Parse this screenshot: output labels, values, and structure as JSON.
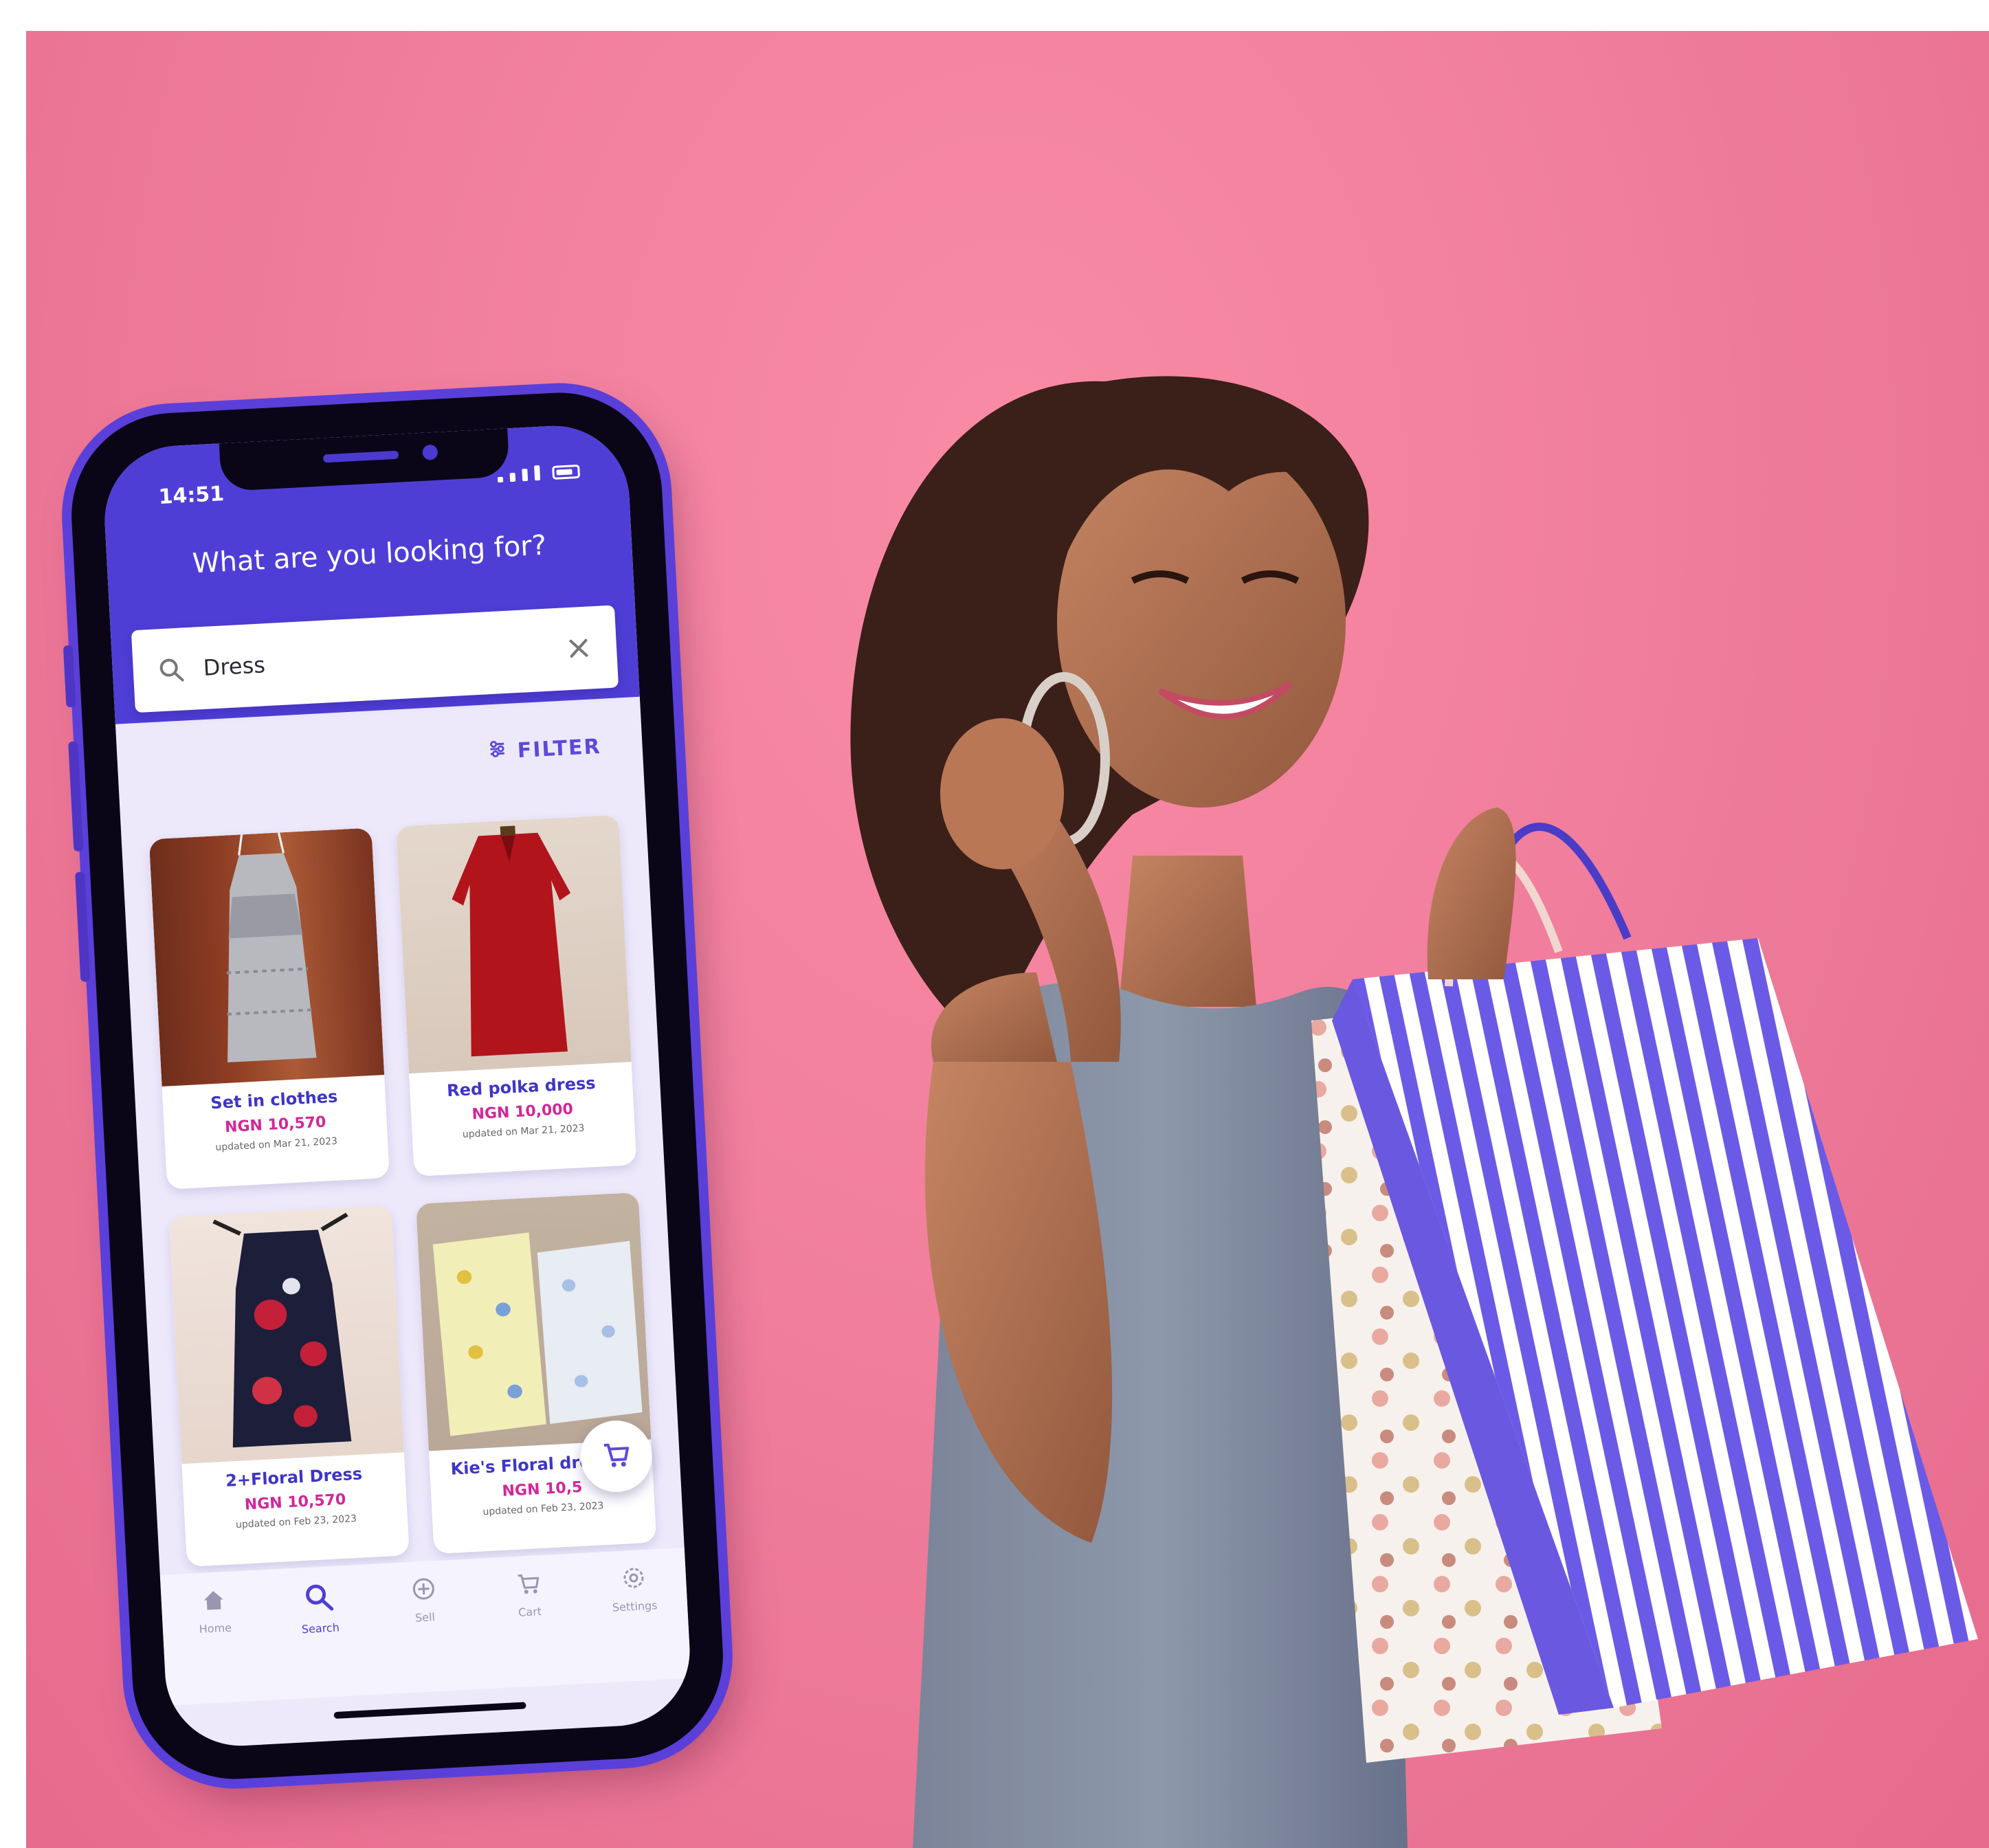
{
  "colors": {
    "background_pink": "#f07e9c",
    "brand_purple": "#4f3ed6",
    "price_magenta": "#d1279a"
  },
  "status_bar": {
    "time": "14:51"
  },
  "header": {
    "title": "What are you looking for?"
  },
  "search": {
    "value": "Dress"
  },
  "filter": {
    "label": "FILTER"
  },
  "products": [
    {
      "title": "Set in clothes",
      "price": "NGN 10,570",
      "updated": "updated on Mar 21, 2023"
    },
    {
      "title": "Red polka dress",
      "price": "NGN 10,000",
      "updated": "updated on Mar 21, 2023"
    },
    {
      "title": "2+Floral Dress",
      "price": "NGN 10,570",
      "updated": "updated on Feb 23, 2023"
    },
    {
      "title": "Kie's Floral dresses",
      "price": "NGN 10,5",
      "updated": "updated on Feb 23, 2023"
    }
  ],
  "bottom_nav": [
    {
      "label": "Home",
      "icon": "home-icon"
    },
    {
      "label": "Search",
      "icon": "search-icon"
    },
    {
      "label": "Sell",
      "icon": "sell-icon"
    },
    {
      "label": "Cart",
      "icon": "cart-icon"
    },
    {
      "label": "Settings",
      "icon": "gear-icon"
    }
  ]
}
